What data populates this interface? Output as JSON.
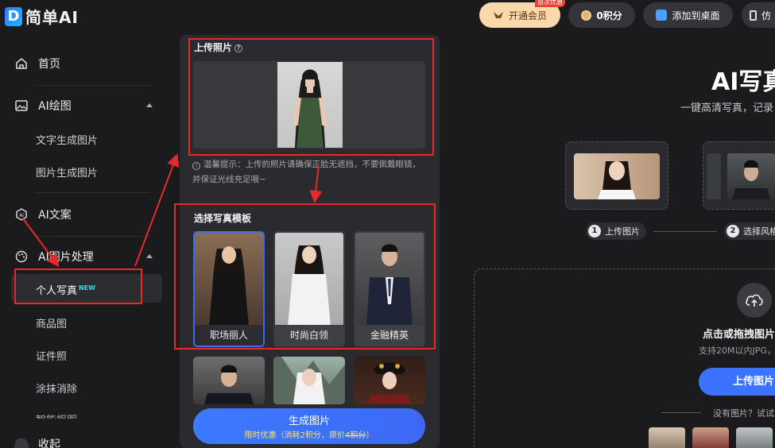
{
  "app": {
    "logo_letter": "D",
    "logo_text": "简单AI"
  },
  "topbar": {
    "vip_label": "开通会员",
    "vip_badge": "首次优惠",
    "points_label": "0积分",
    "add_desktop_label": "添加到桌面",
    "more_label": "仿"
  },
  "sidebar": {
    "home": "首页",
    "ai_drawing": "AI绘图",
    "text_to_image": "文字生成图片",
    "image_to_image": "图片生成图片",
    "ai_copy": "AI文案",
    "ai_image_processing": "AI图片处理",
    "portrait": "个人写真",
    "new_tag": "NEW",
    "product_image": "商品图",
    "id_photo": "证件照",
    "erase": "涂抹消除",
    "cutoff_item": "智能抠图",
    "bottom_item": "收起"
  },
  "panel": {
    "upload_title": "上传照片",
    "help_symbol": "?",
    "tip_icon": "!",
    "tip_text": "温馨提示：上传的照片请确保正脸无遮挡，不要佩戴眼镜，并保证光线充足哦~",
    "template_title": "选择写真模板",
    "templates": [
      {
        "label": "职场丽人"
      },
      {
        "label": "时尚白领"
      },
      {
        "label": "金融精英"
      }
    ],
    "generate_label": "生成图片",
    "generate_sub_prefix": "限时优惠（消耗2积分，原价",
    "generate_sub_strike": "4积分",
    "generate_sub_suffix": "）"
  },
  "right": {
    "hero_title": "AI写真",
    "hero_sub": "一键高清写真，记录",
    "step1_num": "1",
    "step1_label": "上传图片",
    "step2_num": "2",
    "step2_label": "选择风格",
    "drop_title": "点击或拖拽图片",
    "drop_sub": "支持20M以内JPG，",
    "upload_button": "上传图片",
    "no_image_text": "没有图片？试试"
  },
  "colors": {
    "accent_blue": "#3b73ff",
    "annotation_red": "#e52a2a",
    "vip_gold": "#f9d9ac",
    "background": "#1b1b1e"
  }
}
